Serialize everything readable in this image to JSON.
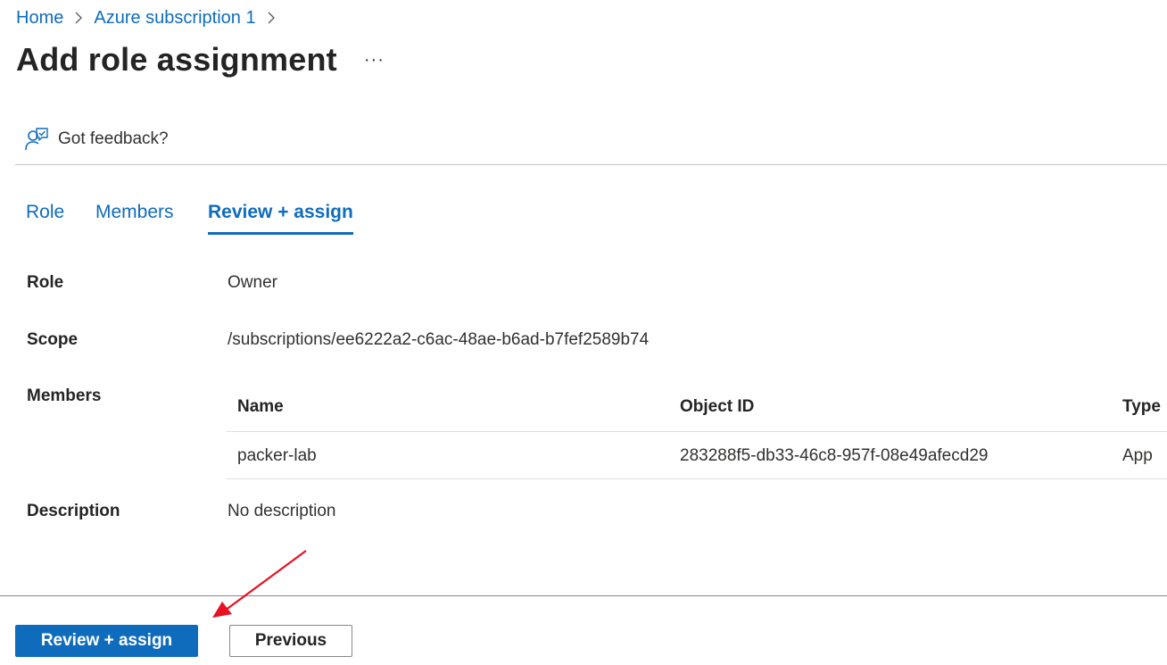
{
  "breadcrumb": {
    "items": [
      "Home",
      "Azure subscription 1"
    ]
  },
  "header": {
    "title": "Add role assignment",
    "more_label": "···"
  },
  "toolbar": {
    "feedback_label": "Got feedback?",
    "feedback_icon": "feedback-person-icon"
  },
  "tabs": [
    {
      "label": "Role",
      "active": false
    },
    {
      "label": "Members",
      "active": false
    },
    {
      "label": "Review + assign",
      "active": true
    }
  ],
  "details": {
    "role_label": "Role",
    "role_value": "Owner",
    "scope_label": "Scope",
    "scope_value": "/subscriptions/ee6222a2-c6ac-48ae-b6ad-b7fef2589b74",
    "members_label": "Members",
    "description_label": "Description",
    "description_value": "No description"
  },
  "members_table": {
    "columns": [
      "Name",
      "Object ID",
      "Type"
    ],
    "rows": [
      [
        "packer-lab",
        "283288f5-db33-46c8-957f-08e49afecd29",
        "App"
      ]
    ]
  },
  "footer": {
    "primary_label": "Review + assign",
    "secondary_label": "Previous"
  },
  "colors": {
    "accent": "#0f6cbd",
    "annotation_arrow": "#e81123"
  }
}
